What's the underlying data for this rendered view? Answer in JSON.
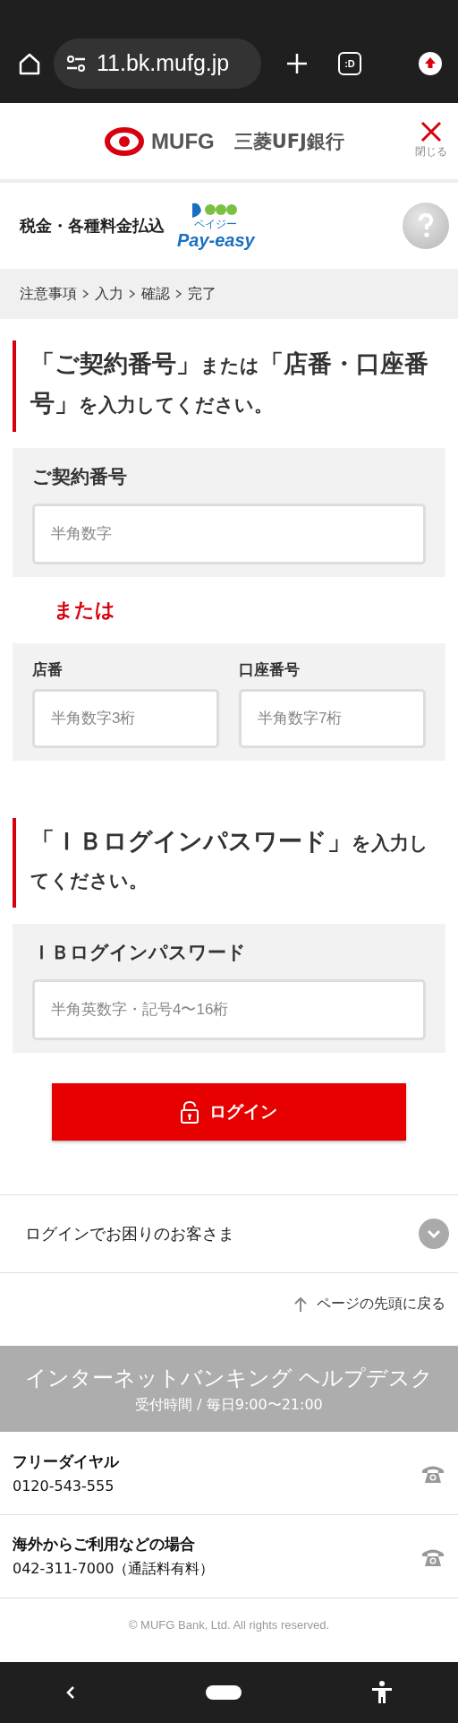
{
  "browser": {
    "url": "11.bk.mufg.jp",
    "tabs_label": ":D"
  },
  "header": {
    "logo_mark": "MUFG",
    "logo_name": "三菱UFJ銀行",
    "close_label": "閉じる"
  },
  "title": {
    "text": "税金・各種料金払込",
    "payeasy": "Pay-easy",
    "payeasy_kana": "ペイジー"
  },
  "breadcrumb": [
    "注意事項",
    "入力",
    "確認",
    "完了"
  ],
  "sections": [
    {
      "heading": [
        {
          "text": "「ご契約番号」",
          "big": true
        },
        {
          "text": "または",
          "big": false
        },
        {
          "text": "「店番・口座番号」",
          "big": true
        },
        {
          "text": "を入力してください。",
          "big": false
        }
      ],
      "groups": [
        {
          "kind": "single",
          "fields": [
            {
              "label": "ご契約番号",
              "placeholder": "半角数字"
            }
          ]
        },
        {
          "kind": "separator",
          "text": "または"
        },
        {
          "kind": "pair",
          "fields": [
            {
              "label": "店番",
              "placeholder": "半角数字3桁"
            },
            {
              "label": "口座番号",
              "placeholder": "半角数字7桁"
            }
          ]
        }
      ]
    },
    {
      "heading": [
        {
          "text": "「ＩＢログインパスワード」",
          "big": true
        },
        {
          "text": "を入力してください。",
          "big": false
        }
      ],
      "groups": [
        {
          "kind": "single",
          "fields": [
            {
              "label": "ＩＢログインパスワード",
              "placeholder": "半角英数字・記号4〜16桁"
            }
          ]
        }
      ]
    }
  ],
  "login_button": "ログイン",
  "help_accordion": {
    "label": "ログインでお困りのお客さま",
    "expanded": false
  },
  "page_top": "ページの先頭に戻る",
  "helpdesk": {
    "title": "インターネットバンキング ヘルプデスク",
    "hours": "受付時間 / 毎日9:00〜21:00",
    "lines": [
      {
        "name": "フリーダイヤル",
        "number": "0120-543-555"
      },
      {
        "name": "海外からご利用などの場合",
        "number": "042-311-7000（通話料有料）"
      }
    ]
  },
  "copyright": "© MUFG Bank, Ltd. All rights reserved."
}
